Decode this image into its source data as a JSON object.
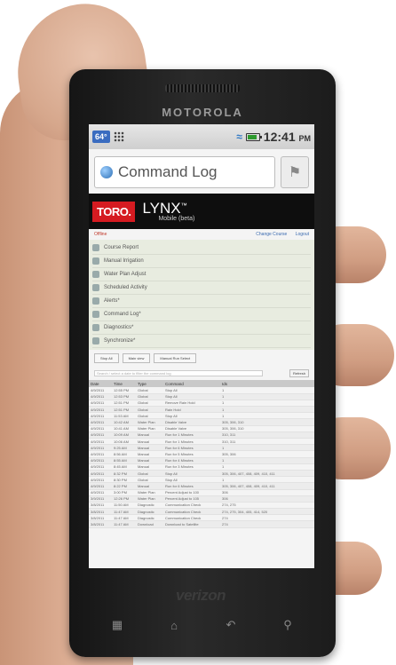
{
  "device": {
    "brand": "MOTOROLA",
    "carrier": "verizon",
    "hardware_keys": [
      "menu-key",
      "home-key",
      "back-key",
      "search-key"
    ]
  },
  "status_bar": {
    "temperature": "64°",
    "time": "12:41",
    "ampm": "PM",
    "wifi_icon": "wifi-icon",
    "battery_color": "#2e9a2e"
  },
  "browser": {
    "page_title": "Command Log"
  },
  "app": {
    "logo": "TORO.",
    "product": "LYNX",
    "trademark": "™",
    "subtitle": "Mobile (beta)",
    "brand_color": "#d51b21",
    "offline_link": "Offline",
    "change_course_link": "Change Course",
    "logout_link": "Logout",
    "menu": [
      {
        "label": "Course Report"
      },
      {
        "label": "Manual Irrigation"
      },
      {
        "label": "Water Plan Adjust"
      },
      {
        "label": "Scheduled Activity"
      },
      {
        "label": "Alerts*"
      },
      {
        "label": "Command Log*"
      },
      {
        "label": "Diagnostics*"
      },
      {
        "label": "Synchronize*"
      }
    ],
    "buttons": [
      "Stop All",
      "Main view",
      "Manual Run Select"
    ],
    "filter_placeholder": "Search / select a date to filter the command log",
    "filter_button": "Refresh"
  },
  "log": {
    "columns": [
      "Date",
      "Time",
      "Type",
      "Command",
      "Ids"
    ],
    "rows": [
      [
        "4/9/2011",
        "12:55 PM",
        "Global",
        "Stop All",
        "1"
      ],
      [
        "4/9/2011",
        "12:53 PM",
        "Global",
        "Stop All",
        "1"
      ],
      [
        "4/9/2011",
        "12:51 PM",
        "Global",
        "Remove Rain Hold",
        "1"
      ],
      [
        "4/9/2011",
        "12:51 PM",
        "Global",
        "Rain Hold",
        "1"
      ],
      [
        "4/9/2011",
        "11:53 AM",
        "Global",
        "Stop All",
        "1"
      ],
      [
        "4/9/2011",
        "10:42 AM",
        "Water Plan",
        "Disable Valve",
        "305, 306, 310"
      ],
      [
        "4/9/2011",
        "10:41 AM",
        "Water Plan",
        "Disable Valve",
        "305, 306, 310"
      ],
      [
        "4/9/2011",
        "10:09 AM",
        "Manual",
        "Run for 1 Minutes",
        "310, 311"
      ],
      [
        "4/9/2011",
        "10:06 AM",
        "Manual",
        "Run for 1 Minutes",
        "310, 311"
      ],
      [
        "4/9/2011",
        "9:25 AM",
        "Manual",
        "Run for 6 Minutes",
        "1"
      ],
      [
        "4/9/2011",
        "8:56 AM",
        "Manual",
        "Run for 5 Minutes",
        "305, 306"
      ],
      [
        "4/9/2011",
        "8:55 AM",
        "Manual",
        "Run for 4 Minutes",
        "1"
      ],
      [
        "4/9/2011",
        "8:45 AM",
        "Manual",
        "Run for 3 Minutes",
        "1"
      ],
      [
        "4/9/2011",
        "8:32 PM",
        "Global",
        "Stop All",
        "305, 306, 407, 408, 409, 410, 411"
      ],
      [
        "4/9/2011",
        "8:30 PM",
        "Global",
        "Stop All",
        "1"
      ],
      [
        "4/9/2011",
        "8:22 PM",
        "Manual",
        "Run for 6 Minutes",
        "305, 306, 407, 408, 409, 410, 411"
      ],
      [
        "4/9/2011",
        "3:00 PM",
        "Water Plan",
        "Percent Adjust to 100",
        "306"
      ],
      [
        "3/9/2011",
        "12:26 PM",
        "Water Plan",
        "Percent Adjust to 105",
        "306"
      ],
      [
        "3/8/2011",
        "11:50 AM",
        "Diagnostic",
        "Communication Check",
        "274, 275"
      ],
      [
        "3/8/2011",
        "11:47 AM",
        "Diagnostic",
        "Communication Check",
        "274, 275, 304, 405, 414, 520"
      ],
      [
        "3/8/2011",
        "11:47 AM",
        "Diagnostic",
        "Communication Check",
        "274"
      ],
      [
        "3/8/2011",
        "11:47 AM",
        "Download",
        "Download to Satellite",
        "274"
      ]
    ]
  }
}
